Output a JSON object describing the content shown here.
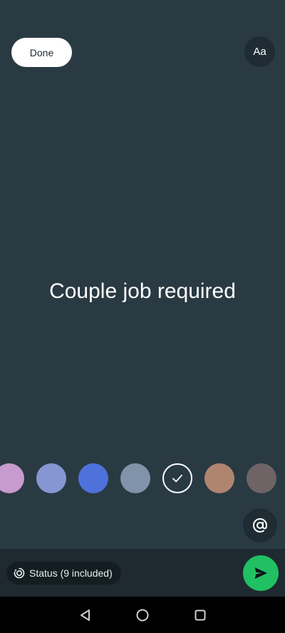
{
  "header": {
    "done_label": "Done",
    "font_label": "Aa"
  },
  "status_text": "Couple job required",
  "palette": {
    "colors": [
      "#c79bcd",
      "#8696d3",
      "#4f71dc",
      "#8193a9",
      "#2a3a42",
      "#b08570",
      "#6e6466"
    ],
    "selected_index": 4,
    "check_icon": "check-icon"
  },
  "mention": {
    "icon": "at-icon"
  },
  "footer": {
    "audience_label": "Status (9 included)",
    "audience_icon": "status-ring-icon",
    "send_icon": "send-icon",
    "send_color": "#21c063"
  },
  "system_nav": {
    "back_icon": "back-triangle-icon",
    "home_icon": "home-circle-icon",
    "recents_icon": "recents-square-icon"
  }
}
